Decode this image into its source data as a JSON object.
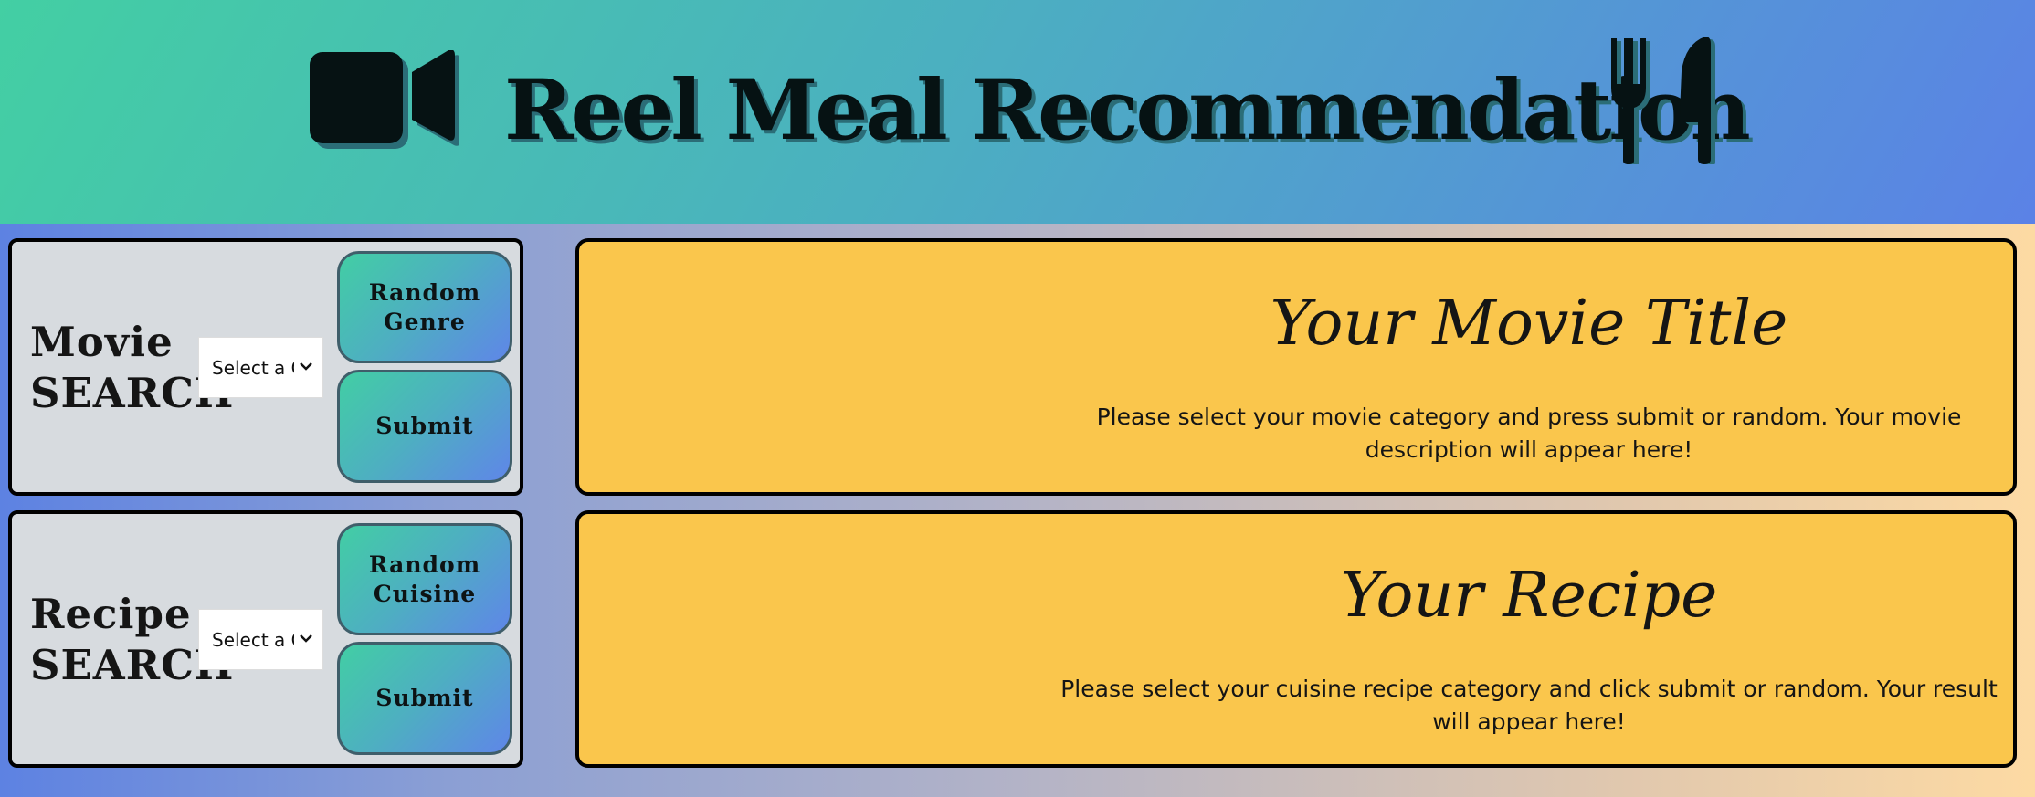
{
  "header": {
    "title": "Reel Meal Recommendation",
    "camera_icon": "video-camera-icon",
    "fork_icon": "fork-icon",
    "knife_icon": "knife-icon"
  },
  "movie_search": {
    "label_line1": "Movie",
    "label_line2": "search",
    "select_value": "Select a Genre",
    "random_line1": "Random",
    "random_line2": "Genre",
    "submit_label": "Submit"
  },
  "recipe_search": {
    "label_line1": "Recipe",
    "label_line2": "search",
    "select_value": "Select a Cuisine",
    "random_line1": "Random",
    "random_line2": "Cuisine",
    "submit_label": "Submit"
  },
  "movie_card": {
    "title": "Your Movie Title",
    "description": "Please select your movie category and press submit or random. Your movie description will appear here!"
  },
  "recipe_card": {
    "title": "Your Recipe",
    "description": "Please select your cuisine recipe category and click submit or random. Your result will appear here!"
  },
  "colors": {
    "header_gradient_start": "#43cfa3",
    "header_gradient_end": "#5b82e6",
    "card_background": "#fac64c",
    "panel_background": "#d7dbdf"
  }
}
